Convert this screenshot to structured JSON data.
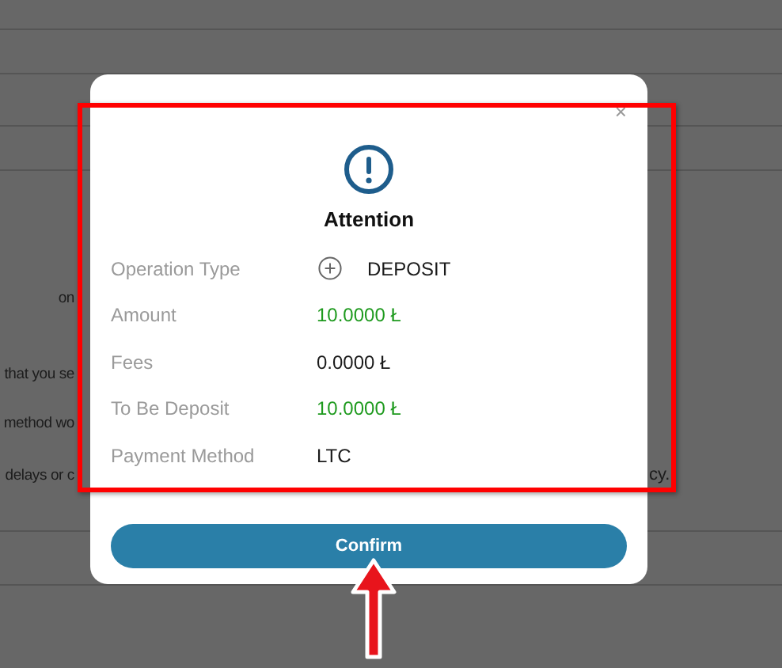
{
  "background": {
    "left_texts": [
      "on",
      "that you se",
      "method wo",
      "delays or c"
    ],
    "right_text": "cy."
  },
  "dialog": {
    "close": "×",
    "title": "Attention",
    "rows": [
      {
        "label": "Operation Type",
        "value": "DEPOSIT",
        "kind": "operation",
        "color": "#1a1a1a"
      },
      {
        "label": "Amount",
        "value": "10.0000 Ł",
        "kind": "text",
        "color": "#1e9a1e"
      },
      {
        "label": "Fees",
        "value": "0.0000 Ł",
        "kind": "text",
        "color": "#1a1a1a"
      },
      {
        "label": "To Be Deposit",
        "value": "10.0000 Ł",
        "kind": "text",
        "color": "#1e9a1e"
      },
      {
        "label": "Payment Method",
        "value": "LTC",
        "kind": "text",
        "color": "#1a1a1a"
      }
    ],
    "button": "Confirm"
  }
}
